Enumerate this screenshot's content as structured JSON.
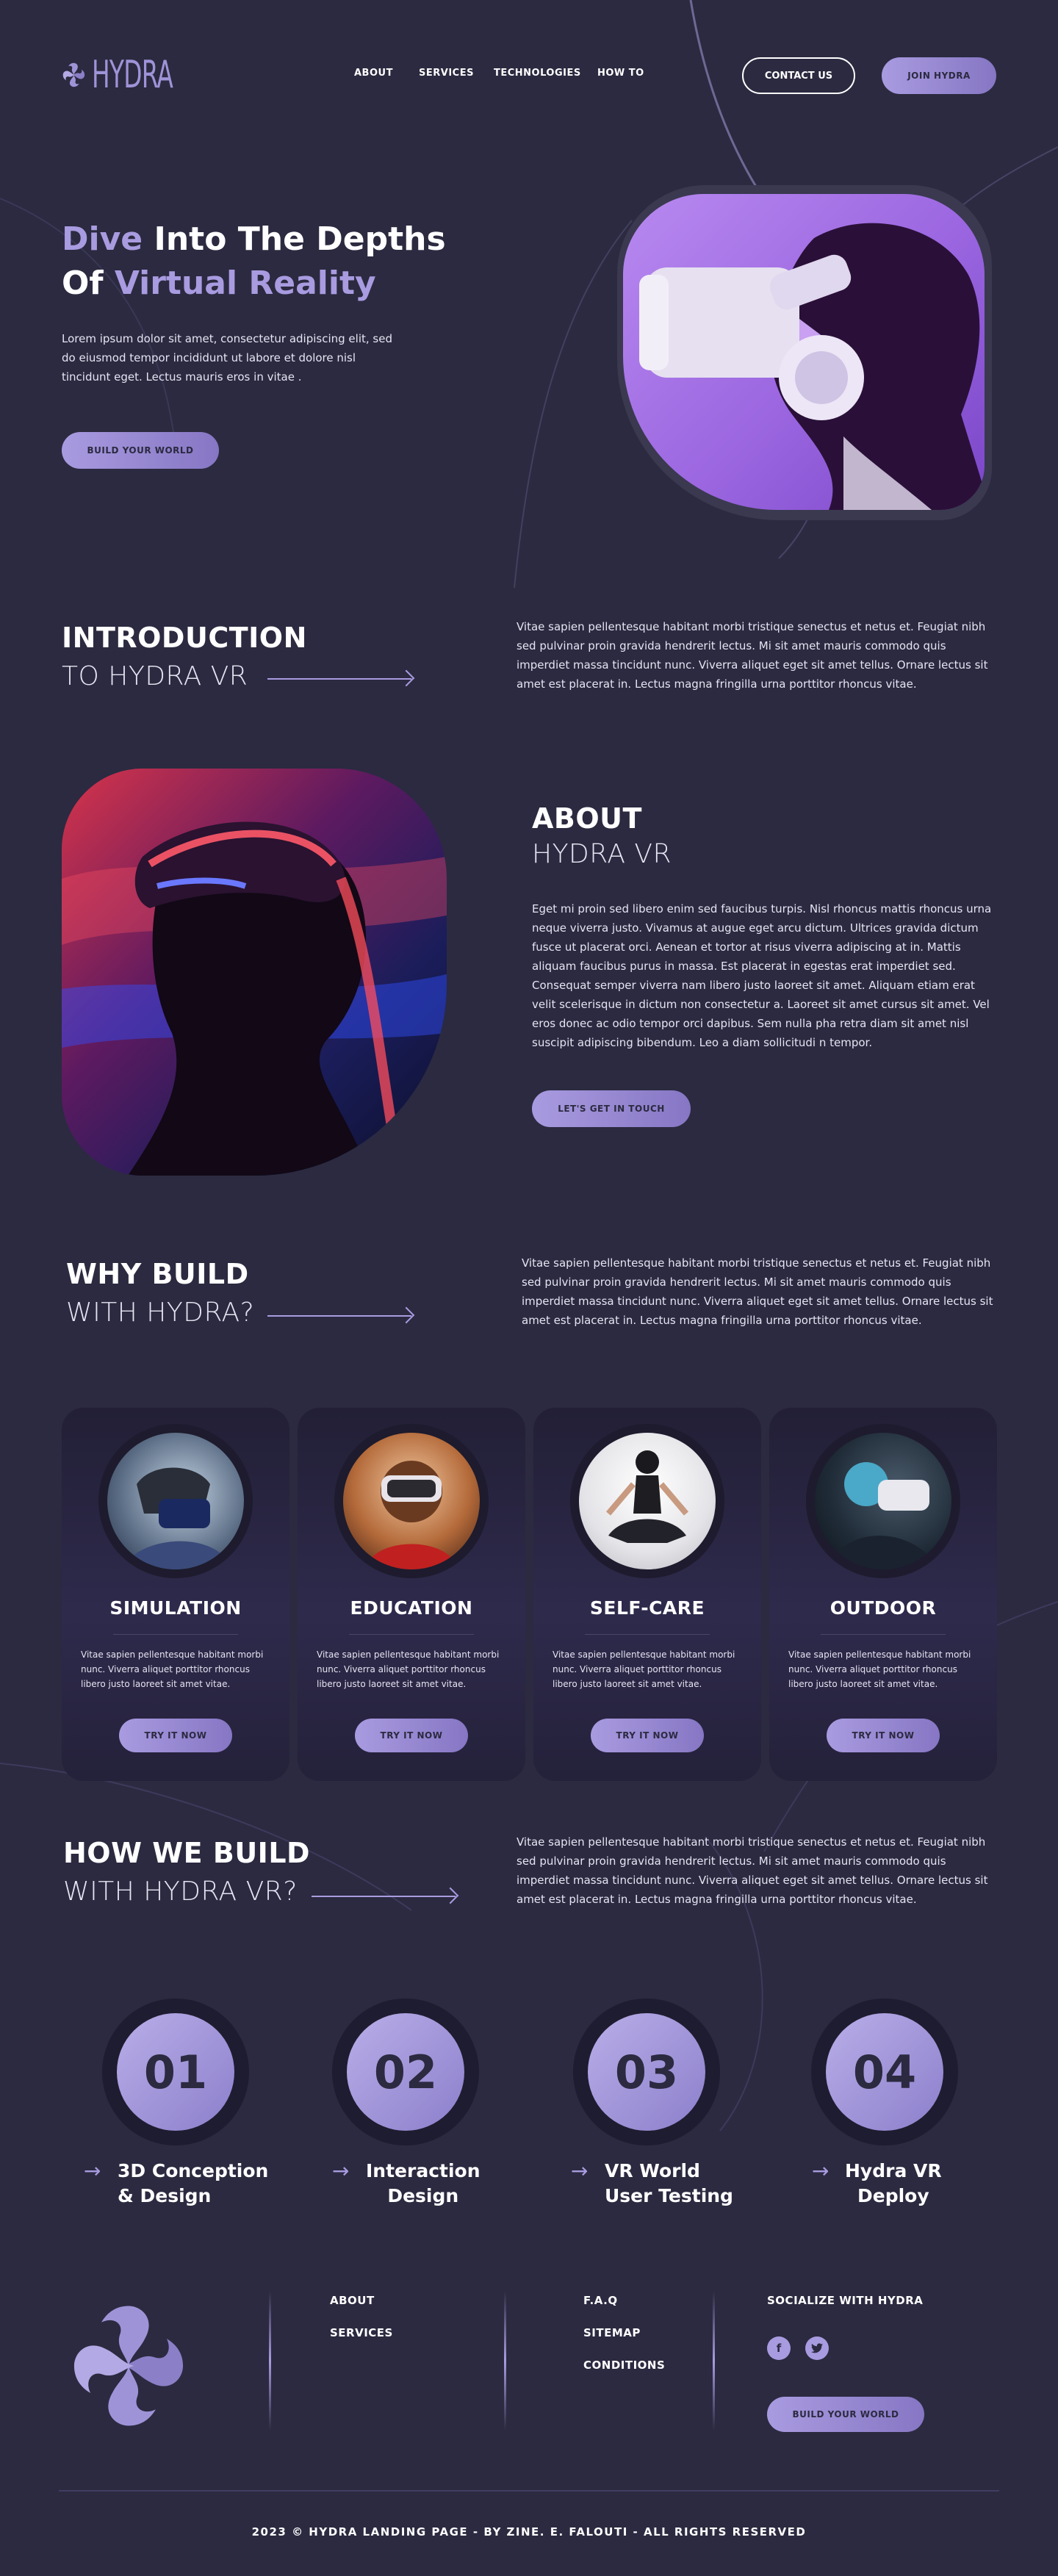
{
  "brand": {
    "name": "HYDRA",
    "accent": "#a99be0",
    "background": "#2b2a40"
  },
  "nav": {
    "links": [
      "ABOUT",
      "SERVICES",
      "TECHNOLOGIES",
      "HOW TO"
    ],
    "contact_label": "CONTACT US",
    "join_label": "JOIN HYDRA"
  },
  "hero": {
    "title_w1": "Dive",
    "title_w2": " Into The Depths",
    "title_w3": "Of ",
    "title_w4": "Virtual Reality",
    "text": "Lorem ipsum dolor sit amet, consectetur adipiscing elit, sed do eiusmod tempor incididunt ut labore et dolore nisl tincidunt eget. Lectus mauris eros in vitae .",
    "cta": "BUILD YOUR WORLD"
  },
  "intro": {
    "title": "INTRODUCTION",
    "subtitle": "TO HYDRA VR",
    "text": "Vitae sapien pellentesque habitant morbi tristique senectus et netus et. Feugiat nibh sed pulvinar proin gravida hendrerit lectus. Mi sit amet mauris commodo quis imperdiet massa tincidunt nunc. Viverra aliquet eget sit amet tellus. Ornare lectus sit amet est placerat in. Lectus magna fringilla urna porttitor rhoncus vitae."
  },
  "about": {
    "title": "ABOUT",
    "subtitle": "HYDRA VR",
    "text": "Eget mi proin sed libero enim sed faucibus turpis. Nisl rhoncus mattis rhoncus urna neque viverra justo. Vivamus at augue eget arcu dictum. Ultrices gravida dictum fusce ut placerat orci. Aenean et tortor at risus viverra adipiscing at in. Mattis aliquam faucibus purus in massa. Est placerat in egestas erat imperdiet sed. Consequat semper viverra nam libero justo laoreet sit amet. Aliquam etiam erat velit scelerisque in dictum non consectetur a. Laoreet sit amet cursus sit amet. Vel eros donec ac odio tempor orci dapibus. Sem nulla pha retra diam sit amet nisl suscipit adipiscing bibendum. Leo a diam sollicitudi n tempor.",
    "cta": "LET'S GET IN TOUCH"
  },
  "why": {
    "title": "WHY BUILD",
    "subtitle": "WITH HYDRA?",
    "text": "Vitae sapien pellentesque habitant morbi tristique senectus et netus et. Feugiat nibh sed pulvinar proin gravida hendrerit lectus. Mi sit amet mauris commodo quis imperdiet massa tincidunt nunc. Viverra aliquet eget sit amet tellus. Ornare lectus sit amet est placerat in. Lectus magna fringilla urna porttitor rhoncus vitae."
  },
  "cards": [
    {
      "title": "SIMULATION",
      "text": "Vitae sapien pellentesque habitant morbi nunc. Viverra aliquet  porttitor rhoncus libero justo laoreet sit amet vitae.",
      "cta": "TRY IT NOW"
    },
    {
      "title": "EDUCATION",
      "text": "Vitae sapien pellentesque habitant morbi nunc. Viverra aliquet  porttitor rhoncus libero justo laoreet sit amet vitae.",
      "cta": "TRY IT NOW"
    },
    {
      "title": "SELF-CARE",
      "text": "Vitae sapien pellentesque habitant morbi nunc. Viverra aliquet  porttitor rhoncus libero justo laoreet sit amet vitae.",
      "cta": "TRY IT NOW"
    },
    {
      "title": "OUTDOOR",
      "text": "Vitae sapien pellentesque habitant morbi nunc. Viverra aliquet  porttitor rhoncus libero justo laoreet sit amet vitae.",
      "cta": "TRY IT NOW"
    }
  ],
  "how": {
    "title": "HOW WE BUILD",
    "subtitle": "WITH HYDRA VR?",
    "text": "Vitae sapien pellentesque habitant morbi tristique senectus et netus et. Feugiat nibh sed pulvinar proin gravida hendrerit lectus. Mi sit amet mauris commodo quis imperdiet massa tincidunt nunc. Viverra aliquet eget sit amet tellus. Ornare lectus sit amet est placerat in. Lectus magna fringilla urna porttitor rhoncus vitae."
  },
  "steps": [
    {
      "number": "01",
      "line1": "3D Conception",
      "line2": "& Design"
    },
    {
      "number": "02",
      "line1": "Interaction",
      "line2": "Design"
    },
    {
      "number": "03",
      "line1": "VR World",
      "line2": "User Testing"
    },
    {
      "number": "04",
      "line1": "Hydra VR",
      "line2": "Deploy"
    }
  ],
  "footer": {
    "col1": [
      "ABOUT",
      "SERVICES"
    ],
    "col2": [
      "F.A.Q",
      "SITEMAP",
      "CONDITIONS"
    ],
    "social_title": "SOCIALIZE WITH HYDRA",
    "social_icons": [
      "facebook-icon",
      "twitter-icon"
    ],
    "cta": "BUILD YOUR WORLD",
    "copyright": "2023 © HYDRA LANDING PAGE - BY ZINE. E. FALOUTI - ALL RIGHTS RESERVED"
  }
}
